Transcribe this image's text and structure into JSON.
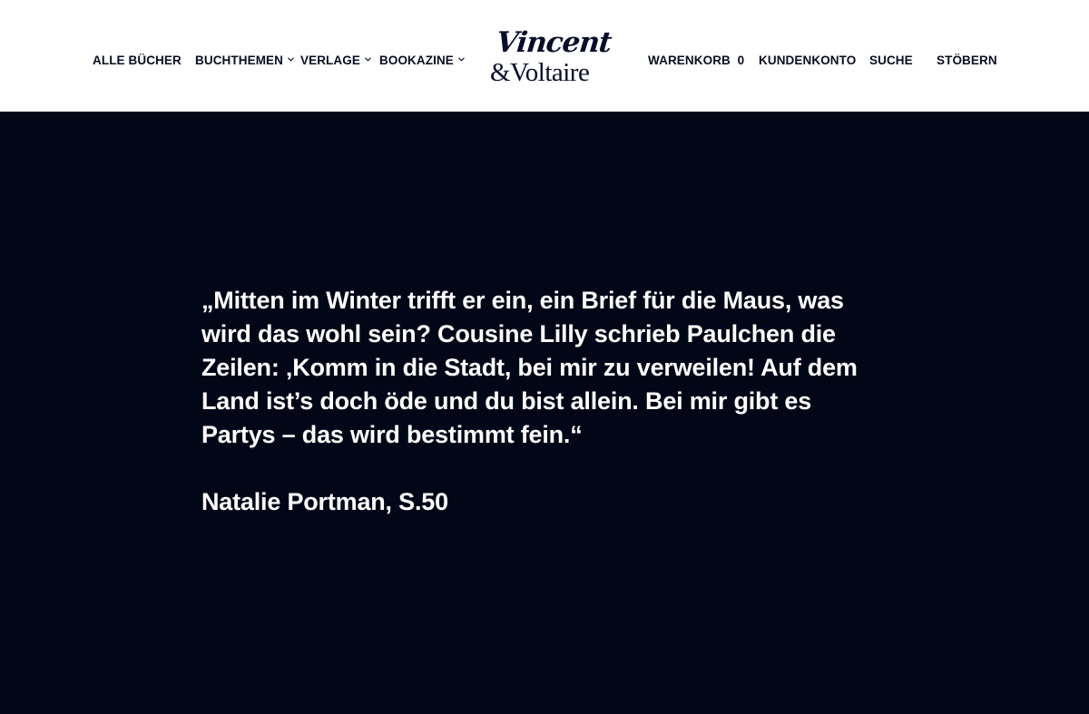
{
  "header": {
    "nav_left": [
      {
        "label": "ALLE BÜCHER"
      },
      {
        "label": "BUCHTHEMEN",
        "dropdown_icon": "chevron-down-icon"
      },
      {
        "label": "VERLAGE",
        "dropdown_icon": "chevron-down-icon"
      },
      {
        "label": "BOOKAZINE",
        "dropdown_icon": "chevron-down-icon"
      }
    ],
    "logo": {
      "line1": "Vincent",
      "line2": "&Voltaire"
    },
    "nav_right": [
      {
        "label": "WARENKORB",
        "count": "0"
      },
      {
        "label": "KUNDENKONTO"
      },
      {
        "label": "SUCHE"
      },
      {
        "label": "STÖBERN"
      }
    ]
  },
  "main": {
    "quote": "„Mitten im Winter trifft er ein, ein Brief für die Maus, was wird das wohl sein? Cousine Lilly schrieb Paulchen die Zeilen: ‚Komm in die Stadt, bei mir zu verweilen! Auf dem Land ist’s doch öde und du bist allein. Bei mir gibt es Partys – das wird bestimmt fein.“",
    "attribution": "Natalie Portman, S.50"
  },
  "colors": {
    "header_bg": "#ffffff",
    "nav_text": "#0a0e1f",
    "main_bg": "#020718",
    "quote_text": "#ffffff"
  }
}
